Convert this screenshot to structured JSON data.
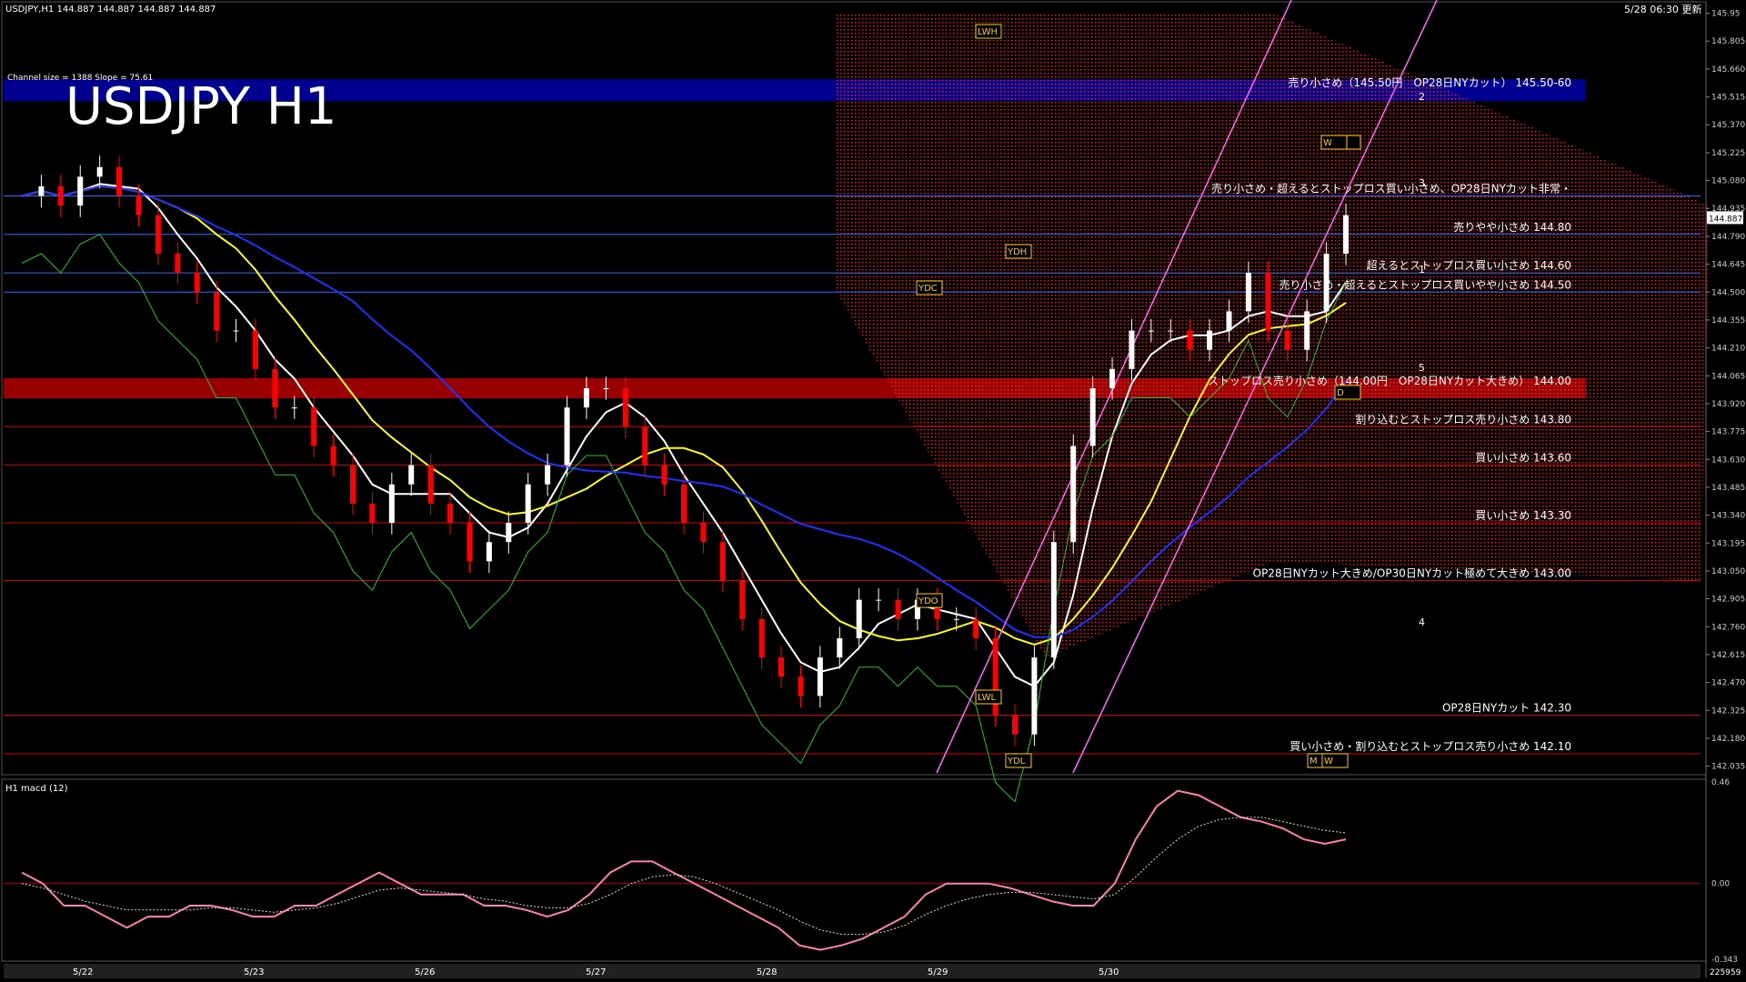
{
  "header": {
    "symbol_info": "USDJPY,H1  144.887 144.887 144.887 144.887",
    "channel_info": "Channel size = 1388 Slope = 75.61",
    "big_title": "USDJPY H1",
    "updated": "5/28 06:30 更新"
  },
  "price_axis": {
    "ticks": [
      "145.95",
      "145.805",
      "145.660",
      "145.515",
      "145.370",
      "145.225",
      "145.080",
      "144.935",
      "144.790",
      "144.645",
      "144.500",
      "144.355",
      "144.210",
      "144.065",
      "143.920",
      "143.775",
      "143.630",
      "143.485",
      "143.340",
      "143.195",
      "143.050",
      "142.905",
      "142.760",
      "142.615",
      "142.470",
      "142.325",
      "142.180",
      "142.035"
    ],
    "current": "144.887"
  },
  "macd_axis": {
    "ticks": [
      "0.46",
      "0.00",
      "-0.343"
    ]
  },
  "macd_title": "H1  macd (12)",
  "dates": [
    "5/22",
    "5/23",
    "5/26",
    "5/27",
    "5/28",
    "5/29",
    "5/30"
  ],
  "bottom_right": "225959",
  "level_markers": [
    "LWH",
    "YDH",
    "YDC",
    "YDO",
    "LWL",
    "YDL",
    "D",
    "W",
    "D",
    "M",
    "W"
  ],
  "trend_numbers": [
    "1",
    "2",
    "3",
    "4",
    "5"
  ],
  "annotations": [
    "売り小さめ（145.50円　OP28日NYカット） 145.50-60",
    "売り小さめ・超えるとストップロス買い小さめ、OP28日NYカット非常・",
    "売りやや小さめ 144.80",
    "超えるとストップロス買い小さめ 144.60",
    "売り小さめ・超えるとストップロス買いやや小さめ 144.50",
    "ストップロス売り小さめ（144.00円　OP28日NYカット大きめ） 144.00",
    "割り込むとストップロス売り小さめ 143.80",
    "買い小さめ 143.60",
    "買い小さめ 143.30",
    "OP28日NYカット大きめ/OP30日NYカット極めて大きめ 143.00",
    "OP28日NYカット 142.30",
    "買い小さめ・割り込むとストップロス売り小さめ 142.10"
  ],
  "colors": {
    "bull_candle": "#ffffff",
    "bear_candle": "#ff0000",
    "sma_white": "#ffffff",
    "sma_yellow": "#ffff00",
    "sma_blue": "#2030ff",
    "chikou": "#22c422",
    "kumo": "#ff3030",
    "macd_up": "#22cc22",
    "macd_down": "#ff7fb0",
    "resistance_band": "#000090",
    "support_band": "#990000"
  },
  "chart_data": {
    "type": "candlestick",
    "symbol": "USDJPY",
    "timeframe": "H1",
    "ylim": [
      142.0,
      146.0
    ],
    "x_categories": [
      "5/22",
      "5/23",
      "5/26",
      "5/27",
      "5/28",
      "5/29",
      "5/30"
    ],
    "close_path": [
      145.0,
      145.05,
      144.95,
      145.1,
      145.15,
      145.0,
      144.9,
      144.7,
      144.6,
      144.5,
      144.3,
      144.3,
      144.1,
      143.9,
      143.9,
      143.7,
      143.6,
      143.4,
      143.3,
      143.5,
      143.6,
      143.4,
      143.3,
      143.1,
      143.2,
      143.3,
      143.5,
      143.6,
      143.9,
      144.0,
      144.0,
      143.8,
      143.6,
      143.5,
      143.3,
      143.2,
      143.0,
      142.8,
      142.6,
      142.5,
      142.4,
      142.6,
      142.7,
      142.9,
      142.9,
      142.8,
      142.9,
      142.8,
      142.8,
      142.7,
      142.3,
      142.2,
      142.6,
      143.2,
      143.7,
      144.0,
      144.1,
      144.3,
      144.3,
      144.3,
      144.2,
      144.3,
      144.4,
      144.6,
      144.3,
      144.2,
      144.4,
      144.7,
      144.9
    ],
    "horizontal_levels": [
      {
        "price": 145.55,
        "label": "売り小さめ（145.50円　OP28日NYカット） 145.50-60",
        "style": "band_blue"
      },
      {
        "price": 145.0,
        "label": "売り小さめ・超えるとストップロス買い小さめ、OP28日NYカット非常・",
        "style": "line_blue"
      },
      {
        "price": 144.8,
        "label": "売りやや小さめ 144.80",
        "style": "line_blue"
      },
      {
        "price": 144.6,
        "label": "超えるとストップロス買い小さめ 144.60",
        "style": "line_blue"
      },
      {
        "price": 144.5,
        "label": "売り小さめ・超えるとストップロス買いやや小さめ 144.50",
        "style": "line_blue"
      },
      {
        "price": 144.0,
        "label": "ストップロス売り小さめ（144.00円　OP28日NYカット大きめ） 144.00",
        "style": "band_red"
      },
      {
        "price": 143.8,
        "label": "割り込むとストップロス売り小さめ 143.80",
        "style": "line_red"
      },
      {
        "price": 143.6,
        "label": "買い小さめ 143.60",
        "style": "line_red"
      },
      {
        "price": 143.3,
        "label": "買い小さめ 143.30",
        "style": "line_red"
      },
      {
        "price": 143.0,
        "label": "OP28日NYカット大きめ/OP30日NYカット極めて大きめ 143.00",
        "style": "line_red"
      },
      {
        "price": 142.3,
        "label": "OP28日NYカット 142.30",
        "style": "line_red"
      },
      {
        "price": 142.1,
        "label": "買い小さめ・割り込むとストップロス売り小さめ 142.10",
        "style": "line_red"
      }
    ],
    "macd_range": [
      -0.343,
      0.46
    ],
    "macd_main": [
      0.05,
      0.0,
      -0.1,
      -0.1,
      -0.15,
      -0.2,
      -0.15,
      -0.15,
      -0.1,
      -0.1,
      -0.12,
      -0.15,
      -0.15,
      -0.1,
      -0.1,
      -0.05,
      0.0,
      0.05,
      0.0,
      -0.05,
      -0.05,
      -0.05,
      -0.1,
      -0.1,
      -0.12,
      -0.15,
      -0.12,
      -0.05,
      0.05,
      0.1,
      0.1,
      0.05,
      0.0,
      -0.05,
      -0.1,
      -0.15,
      -0.2,
      -0.28,
      -0.3,
      -0.28,
      -0.25,
      -0.2,
      -0.15,
      -0.05,
      0.0,
      0.0,
      0.0,
      -0.02,
      -0.05,
      -0.08,
      -0.1,
      -0.1,
      0.0,
      0.2,
      0.35,
      0.42,
      0.4,
      0.35,
      0.3,
      0.28,
      0.25,
      0.2,
      0.18,
      0.2
    ],
    "macd_signal": [
      0.0,
      -0.02,
      -0.05,
      -0.08,
      -0.1,
      -0.12,
      -0.12,
      -0.12,
      -0.12,
      -0.11,
      -0.11,
      -0.12,
      -0.13,
      -0.12,
      -0.11,
      -0.09,
      -0.06,
      -0.03,
      -0.02,
      -0.03,
      -0.04,
      -0.05,
      -0.07,
      -0.08,
      -0.1,
      -0.11,
      -0.11,
      -0.09,
      -0.05,
      0.0,
      0.03,
      0.04,
      0.03,
      0.0,
      -0.04,
      -0.08,
      -0.12,
      -0.17,
      -0.21,
      -0.23,
      -0.23,
      -0.22,
      -0.19,
      -0.14,
      -0.1,
      -0.07,
      -0.05,
      -0.04,
      -0.04,
      -0.05,
      -0.06,
      -0.07,
      -0.05,
      0.03,
      0.12,
      0.2,
      0.26,
      0.29,
      0.3,
      0.3,
      0.28,
      0.26,
      0.24,
      0.23
    ]
  }
}
